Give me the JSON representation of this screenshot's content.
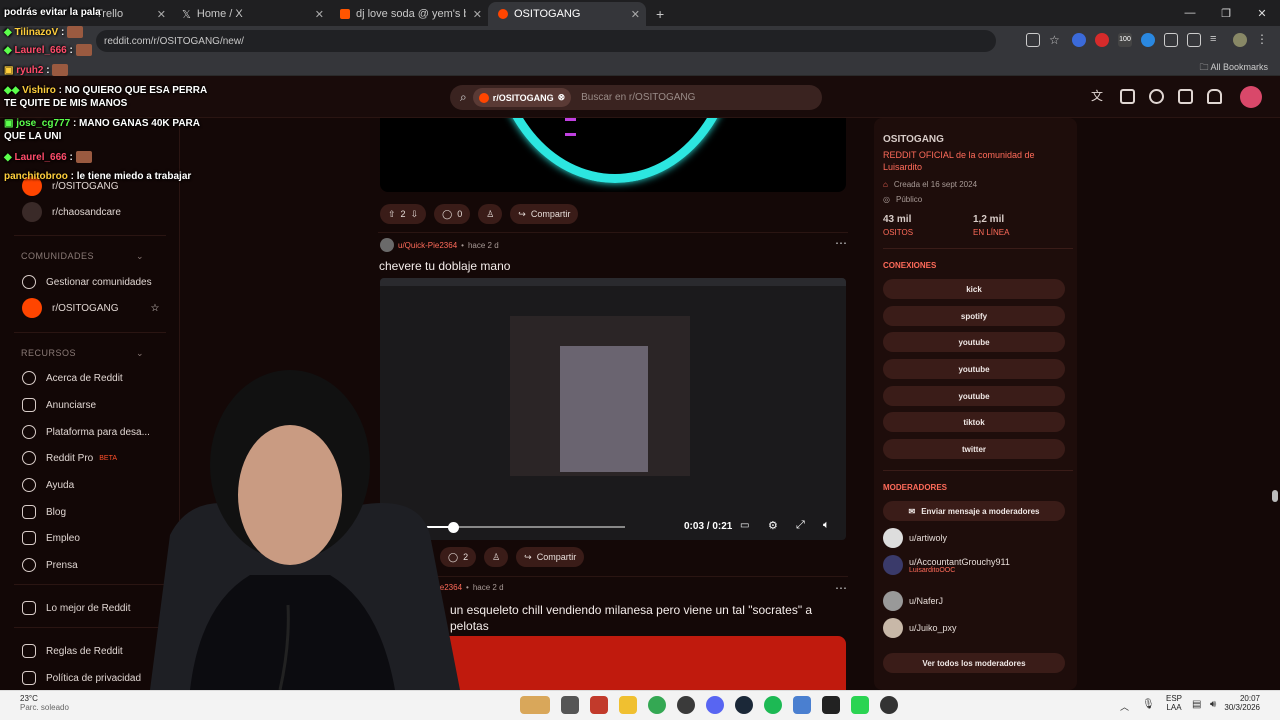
{
  "browser": {
    "tabs": [
      {
        "label": "Trello",
        "active": false
      },
      {
        "label": "Home / X",
        "active": false
      },
      {
        "label": "dj love soda @ yem's birthday",
        "active": false
      },
      {
        "label": "OSITOGANG",
        "active": true
      }
    ],
    "new_tab": "+",
    "url": "reddit.com/r/OSITOGANG/new/",
    "all_bookmarks": "All Bookmarks",
    "ext_badge": "100"
  },
  "reddit_header": {
    "search_chip": "r/OSITOGANG",
    "search_placeholder": "Buscar en r/OSITOGANG"
  },
  "left_sidebar": {
    "subs": [
      "r/OSITOGANG",
      "r/chaosandcare"
    ],
    "communities_heading": "COMUNIDADES",
    "manage_communities": "Gestionar comunidades",
    "community": "r/OSITOGANG",
    "resources_heading": "RECURSOS",
    "resources": [
      "Acerca de Reddit",
      "Anunciarse",
      "Plataforma para desa...",
      "Reddit Pro",
      "Ayuda",
      "Blog",
      "Empleo",
      "Prensa"
    ],
    "beta": "BETA",
    "best_of": "Lo mejor de Reddit",
    "rules": "Reglas de Reddit",
    "privacy": "Política de privacidad"
  },
  "feed": {
    "post1": {
      "votes": "2",
      "comments": "0",
      "share": "Compartir"
    },
    "post2": {
      "user": "u/Quick-Pie2364",
      "time": "hace 2 d",
      "title": "chevere tu doblaje mano",
      "video_time": "0:03 / 0:21",
      "video_progress": 0.14,
      "comments": "2",
      "share": "Compartir"
    },
    "post3": {
      "user": "-Pie2364",
      "time": "hace 2 d",
      "title_line1": "un esqueleto chill vendiendo milanesa pero viene un tal \"socrates\" a",
      "title_line2": "pelotas"
    }
  },
  "right_sidebar": {
    "name": "OSITOGANG",
    "description": "REDDIT OFICIAL de la comunidad de Luisardito",
    "created": "Creada el 16 sept 2024",
    "visibility": "Público",
    "members": "43 mil",
    "members_label": "OSITOS",
    "online": "1,2 mil",
    "online_label": "EN LÍNEA",
    "connections_heading": "CONEXIONES",
    "connections": [
      "kick",
      "spotify",
      "youtube",
      "youtube",
      "youtube",
      "tiktok",
      "twitter"
    ],
    "moderators_heading": "MODERADORES",
    "message_mods": "Enviar mensaje a moderadores",
    "mods": [
      {
        "name": "u/artiwoly",
        "flair": ""
      },
      {
        "name": "u/AccountantGrouchy911",
        "flair": "LuisarditoOOC"
      },
      {
        "name": "u/NaferJ",
        "flair": ""
      },
      {
        "name": "u/Juiko_pxy",
        "flair": ""
      }
    ],
    "view_all_mods": "Ver todos los moderadores"
  },
  "chat_overlay": [
    {
      "user": "",
      "text": "podrás evitar la pala"
    },
    {
      "user": "TilinazoV",
      "text": ":"
    },
    {
      "user": "Laurel_666",
      "text": ":"
    },
    {
      "user": "ryuh2",
      "text": ":"
    },
    {
      "user": "Vishiro",
      "text": ": NO QUIERO QUE ESA PERRA TE QUITE DE MIS MANOS"
    },
    {
      "user": "jose_cg777",
      "text": ": MANO GANAS 40K PARA QUE LA UNI"
    },
    {
      "user": "Laurel_666",
      "text": ":"
    },
    {
      "user": "panchitobroo",
      "text": ": le tiene miedo a trabajar"
    }
  ],
  "taskbar": {
    "temperature": "23°C",
    "weather": "Parc. soleado",
    "lang1": "ESP",
    "lang2": "LAA",
    "time": "20:07",
    "date": "30/3/2026"
  }
}
